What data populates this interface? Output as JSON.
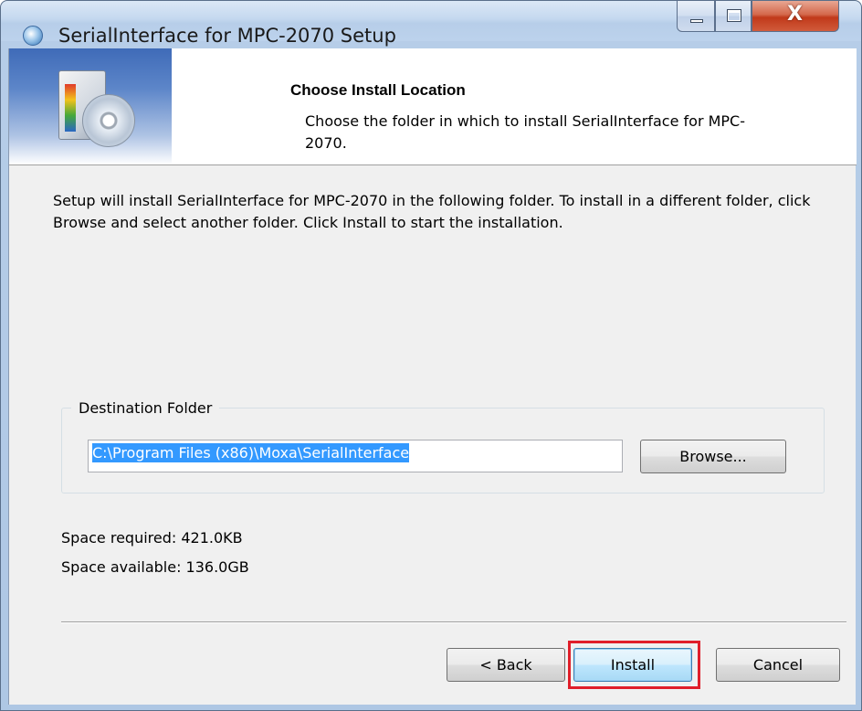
{
  "window": {
    "title": "SerialInterface for MPC-2070 Setup",
    "close_glyph": "X"
  },
  "header": {
    "title": "Choose Install Location",
    "subtitle": "Choose the folder in which to install SerialInterface for MPC-2070."
  },
  "body": {
    "intro": "Setup will install SerialInterface for MPC-2070 in the following folder. To install in a different folder, click Browse and select another folder. Click Install to start the installation."
  },
  "destination": {
    "group_label": "Destination Folder",
    "path": "C:\\Program Files (x86)\\Moxa\\SerialInterface",
    "browse_label": "Browse..."
  },
  "space": {
    "required": "Space required: 421.0KB",
    "available": "Space available: 136.0GB"
  },
  "buttons": {
    "back": "< Back",
    "install": "Install",
    "cancel": "Cancel"
  },
  "colors": {
    "highlight": "#e01e2a",
    "selection": "#3399ff"
  }
}
